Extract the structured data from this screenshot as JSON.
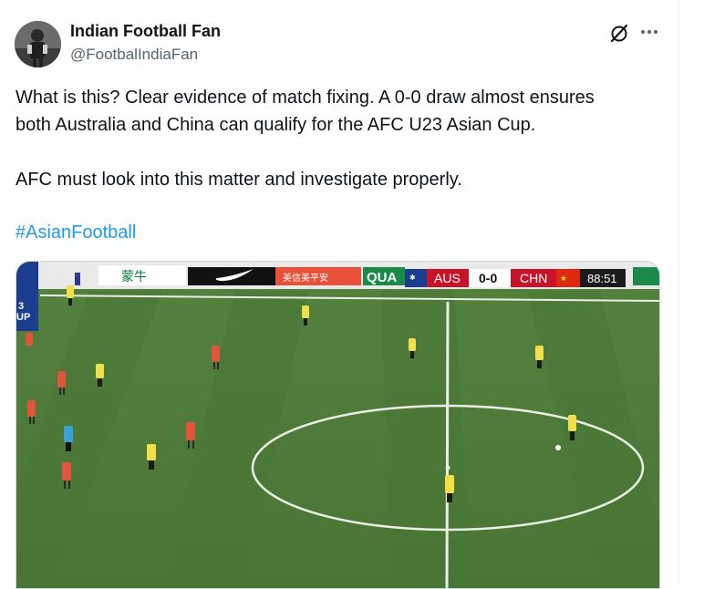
{
  "author": {
    "display_name": "Indian Football Fan",
    "handle": "@FootbalIndiaFan",
    "avatar_icon": "avatar-photo"
  },
  "actions": {
    "grok_icon": "grok-icon",
    "more_icon": "more-options-icon"
  },
  "tweet": {
    "text": "What is this? Clear evidence of match fixing. A 0-0 draw almost ensures\nboth Australia and China can qualify for the AFC U23 Asian Cup.\n\nAFC must look into this matter and investigate properly.",
    "hashtag": "#AsianFootball"
  },
  "media": {
    "type": "video-frame",
    "scoreboard": {
      "home": "AUS",
      "score": "0-0",
      "away": "CHN",
      "clock": "88:51"
    },
    "ad_boards": [
      "QUA",
      "蒙牛",
      "美信美平安"
    ],
    "corner_logo": "3\nUP",
    "colors": {
      "pitch": "#4e7a3a",
      "pitch_dark": "#456f33",
      "china_kit": "#e0553b",
      "australia_kit": "#f1e04a",
      "scoreboard_red": "#c8142b"
    }
  }
}
